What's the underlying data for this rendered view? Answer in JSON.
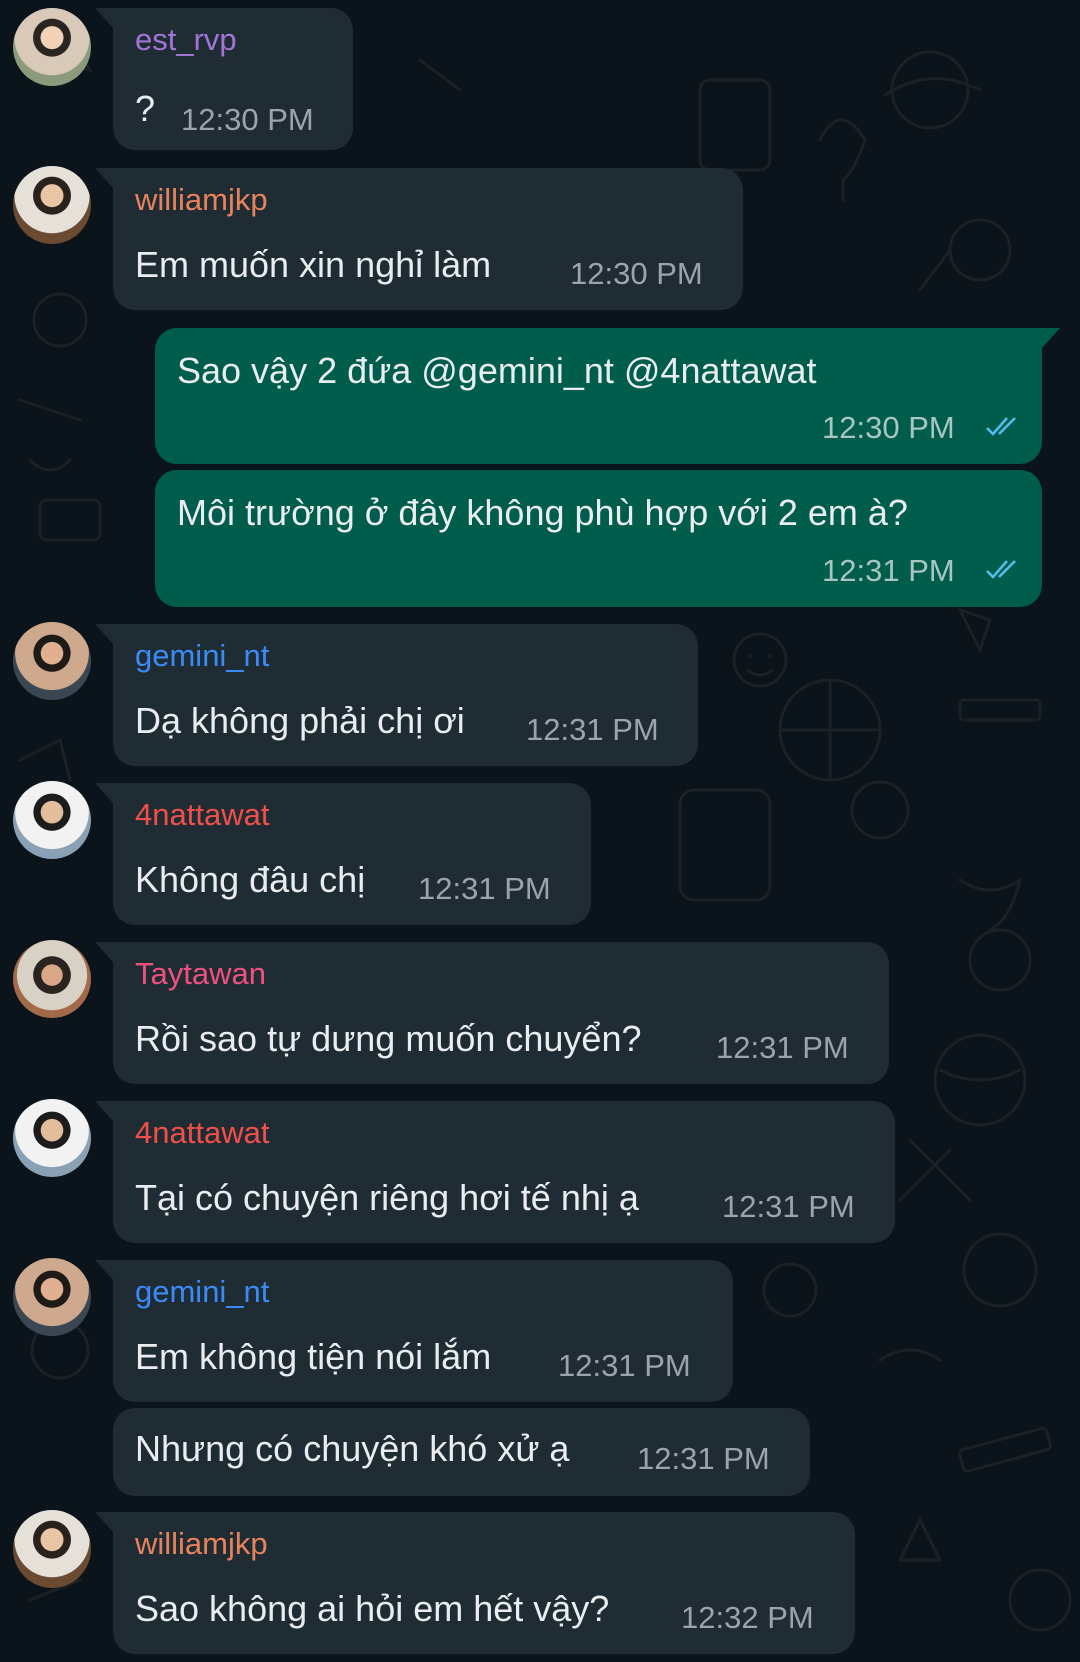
{
  "colors": {
    "background": "#0b141a",
    "incoming_bubble": "#1f2c34",
    "outgoing_bubble": "#005c4b",
    "read_ticks": "#53bdeb",
    "est_rvp": "#a274d6",
    "williamjkp": "#e8825c",
    "gemini_nt": "#3b8bf6",
    "4nattawat": "#f24f4a",
    "Taytawan": "#f0507f"
  },
  "messages": [
    {
      "sender": "est_rvp",
      "text": "?",
      "time": "12:30 PM"
    },
    {
      "sender": "williamjkp",
      "text": "Em muốn xin nghỉ làm",
      "time": "12:30 PM"
    },
    {
      "text": "Sao vậy 2 đứa @gemini_nt @4nattawat",
      "time": "12:30 PM",
      "status": "read-double-check-icon"
    },
    {
      "text": "Môi trường ở đây không phù hợp với 2 em à?",
      "time": "12:31 PM",
      "status": "read-double-check-icon"
    },
    {
      "sender": "gemini_nt",
      "text": "Dạ không phải chị ơi",
      "time": "12:31 PM"
    },
    {
      "sender": "4nattawat",
      "text": "Không đâu chị",
      "time": "12:31 PM"
    },
    {
      "sender": "Taytawan",
      "text": "Rồi sao tự dưng muốn chuyển?",
      "time": "12:31 PM"
    },
    {
      "sender": "4nattawat",
      "text": "Tại có chuyện riêng hơi tế nhị ạ",
      "time": "12:31 PM"
    },
    {
      "sender": "gemini_nt",
      "text": "Em không tiện nói lắm",
      "time": "12:31 PM"
    },
    {
      "text": "Nhưng có chuyện khó xử ạ",
      "time": "12:31 PM"
    },
    {
      "sender": "williamjkp",
      "text": "Sao không ai hỏi em hết vậy?",
      "time": "12:32 PM"
    }
  ]
}
